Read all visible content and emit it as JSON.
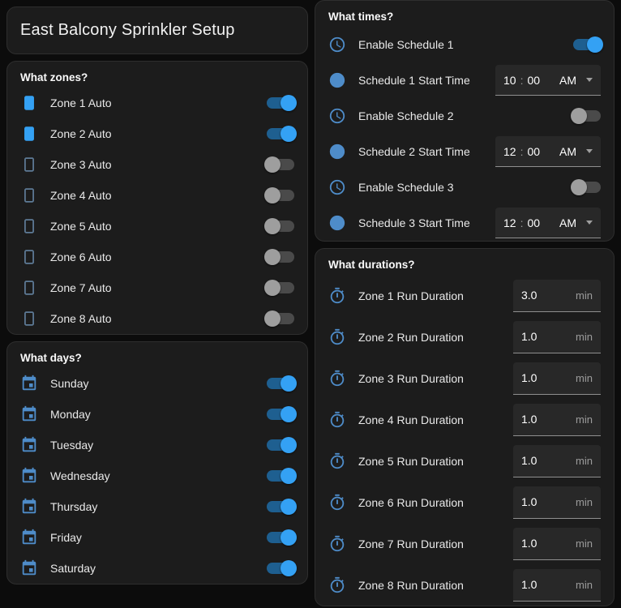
{
  "colors": {
    "accent": "#34a1f4",
    "accent_track": "#1e5f90",
    "icon": "#4e8cc9",
    "icon_dim": "#5e7b97"
  },
  "page": {
    "title": "East Balcony Sprinkler Setup"
  },
  "zones": {
    "header": "What zones?",
    "items": [
      {
        "label": "Zone 1 Auto",
        "on": true
      },
      {
        "label": "Zone 2 Auto",
        "on": true
      },
      {
        "label": "Zone 3 Auto",
        "on": false
      },
      {
        "label": "Zone 4 Auto",
        "on": false
      },
      {
        "label": "Zone 5 Auto",
        "on": false
      },
      {
        "label": "Zone 6 Auto",
        "on": false
      },
      {
        "label": "Zone 7 Auto",
        "on": false
      },
      {
        "label": "Zone 8 Auto",
        "on": false
      }
    ]
  },
  "days": {
    "header": "What days?",
    "items": [
      {
        "label": "Sunday",
        "on": true
      },
      {
        "label": "Monday",
        "on": true
      },
      {
        "label": "Tuesday",
        "on": true
      },
      {
        "label": "Wednesday",
        "on": true
      },
      {
        "label": "Thursday",
        "on": true
      },
      {
        "label": "Friday",
        "on": true
      },
      {
        "label": "Saturday",
        "on": true
      }
    ]
  },
  "times": {
    "header": "What times?",
    "separator": ":",
    "schedules": [
      {
        "enable_label": "Enable Schedule 1",
        "enabled": true,
        "time_label": "Schedule 1 Start Time",
        "hour": "10",
        "minute": "00",
        "period": "AM"
      },
      {
        "enable_label": "Enable Schedule 2",
        "enabled": false,
        "time_label": "Schedule 2 Start Time",
        "hour": "12",
        "minute": "00",
        "period": "AM"
      },
      {
        "enable_label": "Enable Schedule 3",
        "enabled": false,
        "time_label": "Schedule 3 Start Time",
        "hour": "12",
        "minute": "00",
        "period": "AM"
      }
    ]
  },
  "durations": {
    "header": "What durations?",
    "unit": "min",
    "items": [
      {
        "label": "Zone 1 Run Duration",
        "value": "3.0"
      },
      {
        "label": "Zone 2 Run Duration",
        "value": "1.0"
      },
      {
        "label": "Zone 3 Run Duration",
        "value": "1.0"
      },
      {
        "label": "Zone 4 Run Duration",
        "value": "1.0"
      },
      {
        "label": "Zone 5 Run Duration",
        "value": "1.0"
      },
      {
        "label": "Zone 6 Run Duration",
        "value": "1.0"
      },
      {
        "label": "Zone 7 Run Duration",
        "value": "1.0"
      },
      {
        "label": "Zone 8 Run Duration",
        "value": "1.0"
      }
    ]
  }
}
